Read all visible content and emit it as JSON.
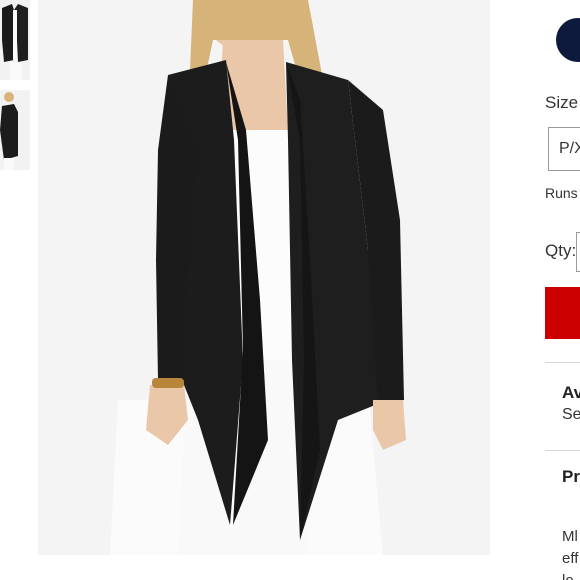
{
  "colors": {
    "swatch": "#0d1a3d",
    "add_to_bag": "#cc0000",
    "garment": "#1a1a1a",
    "background": "#f4f4f4"
  },
  "thumbnails": [
    {
      "icon": "cardigan-front-thumbnail"
    },
    {
      "icon": "cardigan-side-thumbnail"
    }
  ],
  "product_image": {
    "icon": "black-cardigan-photo"
  },
  "options": {
    "size_label": "Size",
    "size_selected": "P/X",
    "fit_note": "Runs",
    "qty_label": "Qty:"
  },
  "sections": {
    "availability_title": "Av",
    "availability_sub": "Se",
    "product_title": "Pr",
    "description_lines": [
      "Ml",
      "eff",
      "lo"
    ]
  }
}
